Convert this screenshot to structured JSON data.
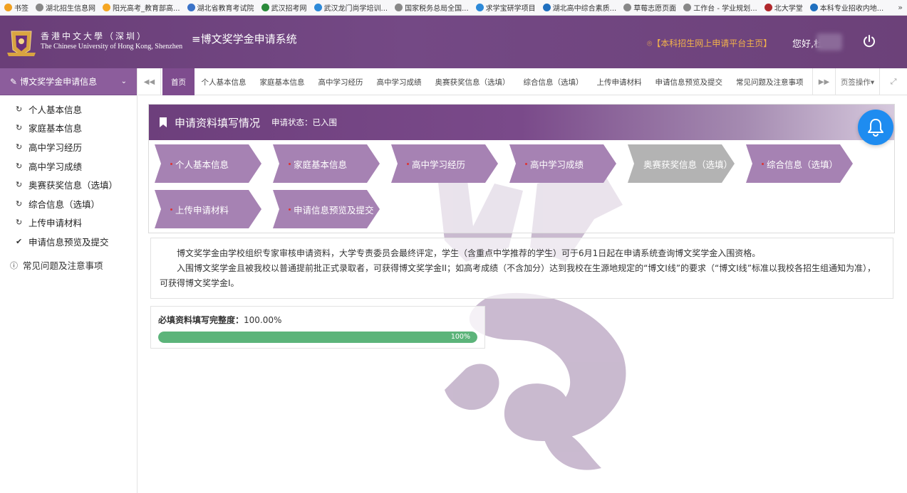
{
  "bookmarks": {
    "items": [
      {
        "label": "书签",
        "color": "#f0a020"
      },
      {
        "label": "湖北招生信息网",
        "color": "#888888"
      },
      {
        "label": "阳光高考_教育部高...",
        "color": "#f5a623"
      },
      {
        "label": "湖北省教育考试院",
        "color": "#3b73c8"
      },
      {
        "label": "武汉招考网",
        "color": "#2a8a3a"
      },
      {
        "label": "武汉龙门尚学培训...",
        "color": "#2d89d8"
      },
      {
        "label": "国家税务总局全国...",
        "color": "#888888"
      },
      {
        "label": "求学宝研学项目",
        "color": "#2d89d8"
      },
      {
        "label": "湖北高中综合素质...",
        "color": "#1f6fbf"
      },
      {
        "label": "草莓志愿页面",
        "color": "#888888"
      },
      {
        "label": "工作台 - 学业规划...",
        "color": "#888888"
      },
      {
        "label": "北大学堂",
        "color": "#b0282c"
      },
      {
        "label": "本科专业招收内地...",
        "color": "#1f6fbf"
      }
    ],
    "more": "»"
  },
  "header": {
    "logo_zh": "香港中文大學（深圳）",
    "logo_en": "The Chinese University of Hong Kong, Shenzhen",
    "system_title": "≡博文奖学金申请系统",
    "portal_link": "【本科招生网上申请平台主页】",
    "greeting": "您好,杜"
  },
  "sidebar": {
    "header": "博文奖学金申请信息",
    "items": [
      {
        "label": "个人基本信息",
        "icon": "↻"
      },
      {
        "label": "家庭基本信息",
        "icon": "↻"
      },
      {
        "label": "高中学习经历",
        "icon": "↻"
      },
      {
        "label": "高中学习成绩",
        "icon": "↻"
      },
      {
        "label": "奥赛获奖信息（选填）",
        "icon": "↻"
      },
      {
        "label": "综合信息（选填）",
        "icon": "↻"
      },
      {
        "label": "上传申请材料",
        "icon": "↻"
      },
      {
        "label": "申请信息预览及提交",
        "icon": "✔"
      }
    ],
    "faq": "常见问题及注意事项"
  },
  "tabs": {
    "items": [
      "首页",
      "个人基本信息",
      "家庭基本信息",
      "高中学习经历",
      "高中学习成绩",
      "奥赛获奖信息（选填）",
      "综合信息（选填）",
      "上传申请材料",
      "申请信息预览及提交",
      "常见问题及注意事项"
    ],
    "active": "首页",
    "ops": "页签操作▾"
  },
  "panel": {
    "title": "申请资料填写情况",
    "status": "申请状态：已入围",
    "steps": [
      {
        "label": "个人基本信息",
        "done": true
      },
      {
        "label": "家庭基本信息",
        "done": true
      },
      {
        "label": "高中学习经历",
        "done": true
      },
      {
        "label": "高中学习成绩",
        "done": true
      },
      {
        "label": "奥赛获奖信息（选填）",
        "done": false
      },
      {
        "label": "综合信息（选填）",
        "done": true
      },
      {
        "label": "上传申请材料",
        "done": true
      },
      {
        "label": "申请信息预览及提交",
        "done": true
      }
    ]
  },
  "info": {
    "p1": "博文奖学金由学校组织专家审核申请资料，大学专责委员会最终评定，学生（含重点中学推荐的学生）可于6月1日起在申请系统查询博文奖学金入围资格。",
    "p2": "入围博文奖学金且被我校以普通提前批正式录取者，可获得博文奖学金II；如高考成绩（不含加分）达到我校在生源地规定的“博文I线”的要求（“博文I线”标准以我校各招生组通知为准），可获得博文奖学金I。"
  },
  "progress": {
    "label": "必填资料填写完整度：",
    "value_text": "100.00%",
    "percent": 100,
    "bar_text": "100%"
  },
  "colors": {
    "header": "#744985",
    "accent": "#7e4c8e",
    "step": "#a682b3",
    "step_inactive": "#b3b3b3",
    "progress": "#5cb47a",
    "bell": "#1e8cf0"
  }
}
